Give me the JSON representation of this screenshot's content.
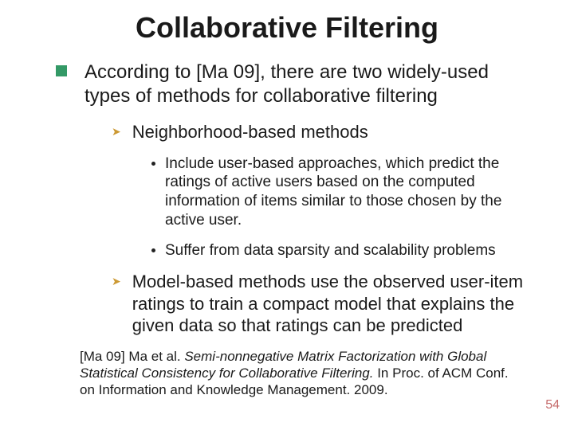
{
  "title": "Collaborative Filtering",
  "main": "According to [Ma 09], there are two widely-used types of methods for collaborative filtering",
  "sub1": "Neighborhood-based methods",
  "dot1": "Include user-based approaches, which predict the ratings of active users based on the computed information of  items similar to those chosen by the active user.",
  "dot2": "Suffer from data sparsity and scalability problems",
  "sub2": "Model-based methods use the observed user-item ratings to train a compact model that explains the given data so that ratings can be predicted",
  "ref_lead": "[Ma 09] Ma et al. ",
  "ref_title": "Semi-nonnegative Matrix Factorization with Global Statistical Consistency for Collaborative Filtering.",
  "ref_tail": " In Proc. of ACM Conf. on Information and Knowledge Management. 2009.",
  "page": "54"
}
